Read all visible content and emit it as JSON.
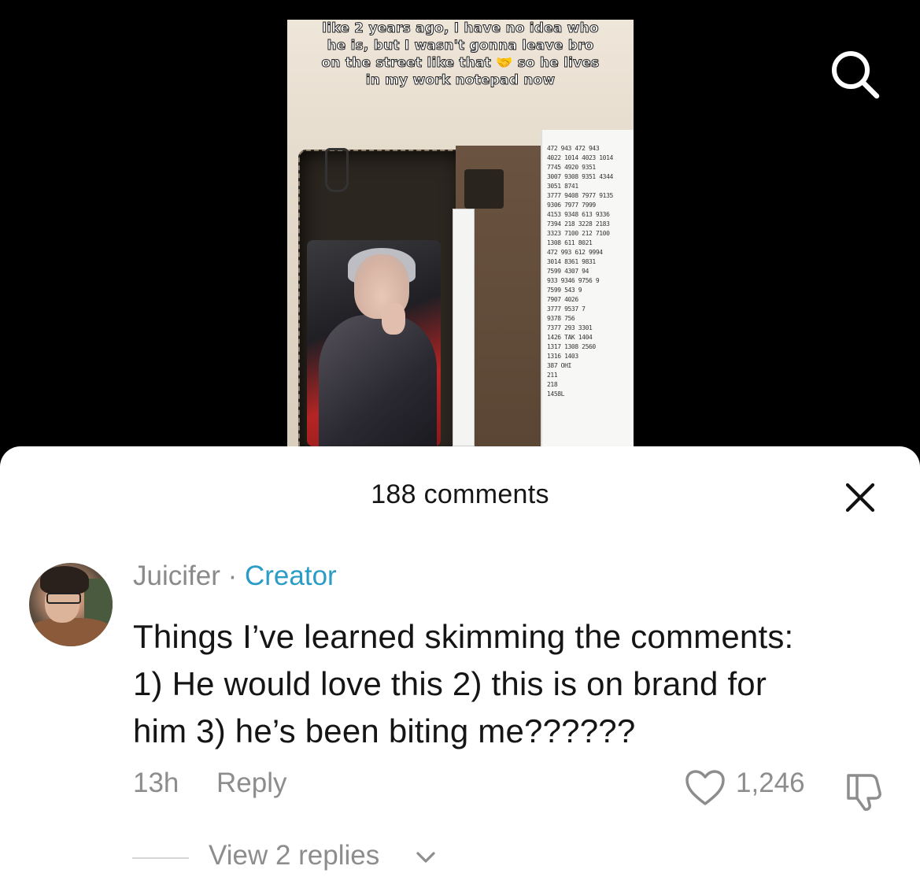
{
  "video": {
    "caption_lines": [
      "like 2 years ago, I have no idea who",
      "he is, but I wasn't gonna leave bro",
      "on the street like that 🤝 so he lives",
      "in my work notepad now"
    ]
  },
  "comments_sheet": {
    "title": "188 comments",
    "comment": {
      "username": "Juicifer",
      "separator": "·",
      "badge": "Creator",
      "text_lines": [
        "Things I’ve learned skimming the comments:",
        "1) He would love this 2) this is on brand for",
        "him 3) he’s been biting me??????"
      ],
      "timestamp": "13h",
      "reply_label": "Reply",
      "like_count": "1,246",
      "view_replies_label": "View 2 replies"
    }
  },
  "colors": {
    "creator_badge": "#2a9cc6",
    "muted_text": "#8d8d8d",
    "sheet_background": "#ffffff",
    "video_background": "#000000"
  },
  "icons": [
    "search-icon",
    "close-icon",
    "heart-icon",
    "dislike-icon",
    "chevron-down-icon"
  ]
}
